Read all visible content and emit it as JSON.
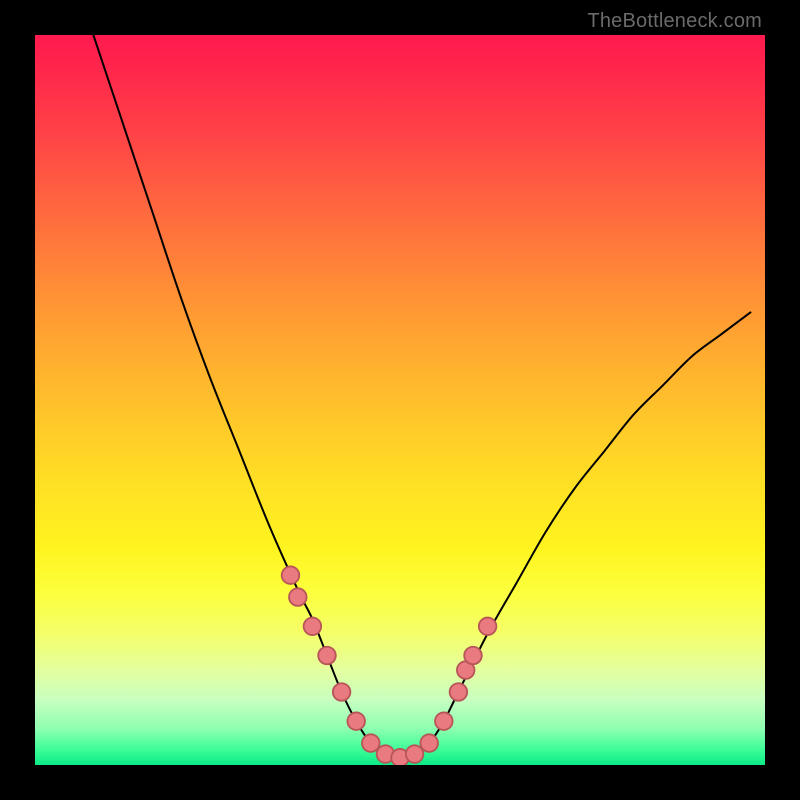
{
  "watermark": "TheBottleneck.com",
  "colors": {
    "bg_black": "#000000",
    "curve_stroke": "#000000",
    "dot_fill": "#e97a7f",
    "dot_stroke": "#b85558",
    "gradient_top": "#ff1a4f",
    "gradient_bottom": "#0aea87"
  },
  "chart_data": {
    "type": "line",
    "title": "",
    "xlabel": "",
    "ylabel": "",
    "xlim": [
      0,
      100
    ],
    "ylim": [
      0,
      100
    ],
    "grid": false,
    "legend": false,
    "note": "Values are normalized 0-100 in each axis. y=0 is the bottom edge (green), y=100 is the top edge (red). x=0 left, x=100 right.",
    "series": [
      {
        "name": "bottleneck-curve",
        "x": [
          8,
          12,
          16,
          20,
          24,
          28,
          32,
          36,
          38,
          40,
          42,
          44,
          46,
          48,
          50,
          52,
          54,
          56,
          58,
          62,
          66,
          70,
          74,
          78,
          82,
          86,
          90,
          94,
          98
        ],
        "y": [
          100,
          88,
          76,
          64,
          53,
          43,
          33,
          24,
          20,
          15,
          10,
          6,
          3,
          1.5,
          1,
          1.5,
          3,
          6,
          10,
          18,
          25,
          32,
          38,
          43,
          48,
          52,
          56,
          59,
          62
        ]
      },
      {
        "name": "highlight-dots",
        "type": "scatter",
        "x": [
          35,
          36,
          38,
          40,
          42,
          44,
          46,
          48,
          50,
          52,
          54,
          56,
          58,
          59,
          60,
          62
        ],
        "y": [
          26,
          23,
          19,
          15,
          10,
          6,
          3,
          1.5,
          1,
          1.5,
          3,
          6,
          10,
          13,
          15,
          19
        ]
      }
    ]
  }
}
